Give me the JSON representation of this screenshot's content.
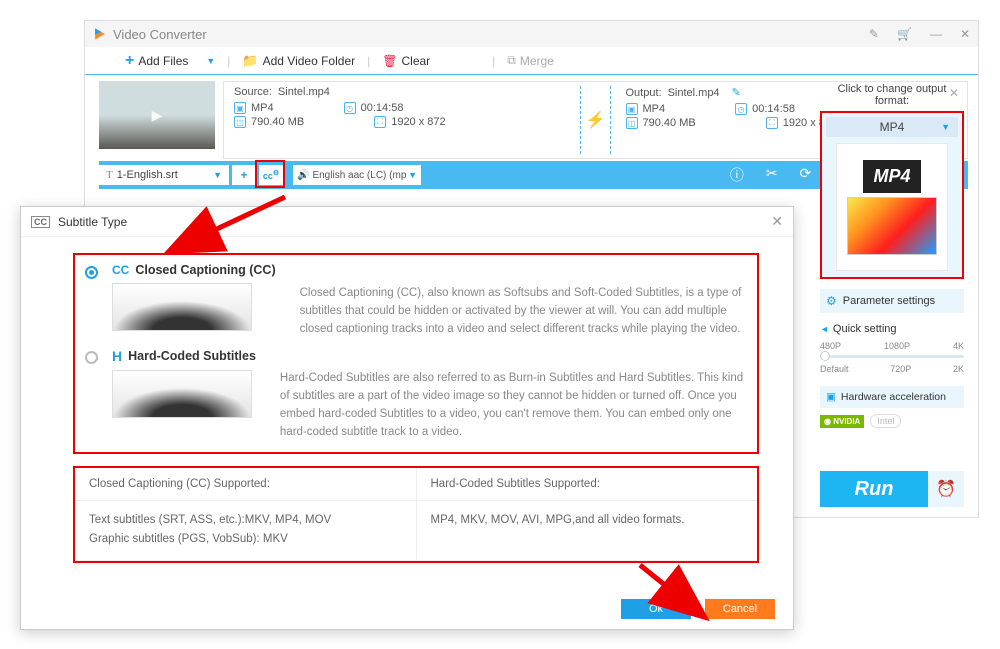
{
  "app": {
    "title": "Video Converter"
  },
  "toolbar": {
    "add_files": "Add Files",
    "add_folder": "Add Video Folder",
    "clear": "Clear",
    "merge": "Merge"
  },
  "media": {
    "source_label": "Source:",
    "source_file": "Sintel.mp4",
    "output_label": "Output:",
    "output_file": "Sintel.mp4",
    "format": "MP4",
    "duration": "00:14:58",
    "size": "790.40 MB",
    "resolution": "1920 x 872"
  },
  "subtitle_bar": {
    "selected": "1-English.srt",
    "audio": "English aac (LC) (mp"
  },
  "right": {
    "header": "Click to change output format:",
    "format": "MP4",
    "param": "Parameter settings",
    "quick": "Quick setting",
    "res": [
      "480P",
      "1080P",
      "4K",
      "Default",
      "720P",
      "2K"
    ],
    "hw": "Hardware acceleration",
    "nvidia": "NVIDIA",
    "intel": "Intel",
    "run": "Run"
  },
  "dialog": {
    "title": "Subtitle Type",
    "cc": {
      "label": "Closed Captioning (CC)",
      "desc": "Closed Captioning (CC), also known as Softsubs and Soft-Coded Subtitles, is a type of subtitles that could be hidden or activated by the viewer at will. You can add multiple closed captioning tracks into a video and select different tracks while playing the video."
    },
    "hard": {
      "label": "Hard-Coded Subtitles",
      "desc": "Hard-Coded Subtitles are also referred to as Burn-in Subtitles and Hard Subtitles. This kind of subtitles are a part of the video image so they cannot be hidden or turned off. Once you embed hard-coded Subtitles to a video, you can't remove them. You can embed only one hard-coded subtitle track to a video."
    },
    "support": {
      "cc_header": "Closed Captioning (CC) Supported:",
      "hard_header": "Hard-Coded Subtitles Supported:",
      "cc_body1": "Text subtitles (SRT, ASS, etc.):MKV, MP4, MOV",
      "cc_body2": "Graphic subtitles (PGS, VobSub): MKV",
      "hard_body": "MP4, MKV, MOV, AVI, MPG,and all video formats."
    },
    "ok": "Ok",
    "cancel": "Cancel"
  }
}
